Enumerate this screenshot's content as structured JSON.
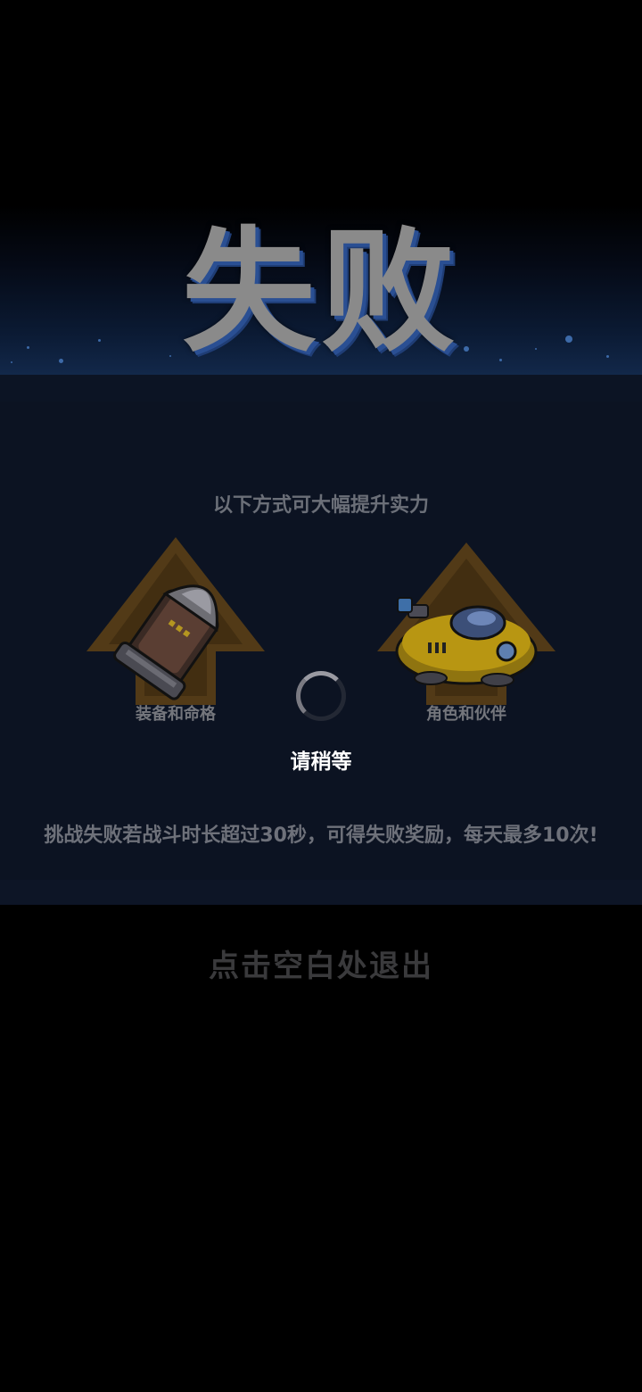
{
  "header": {
    "title": "失败"
  },
  "panel": {
    "subtitle": "以下方式可大幅提升实力",
    "options": [
      {
        "label": "装备和命格",
        "icon": "equipment-icon"
      },
      {
        "label": "角色和伙伴",
        "icon": "vehicle-icon"
      }
    ],
    "loading_label": "请稍等",
    "notice": "挑战失败若战斗时长超过30秒，可得失败奖励，每天最多10次!"
  },
  "footer": {
    "exit_hint": "点击空白处退出"
  },
  "colors": {
    "title": "#8a8a8a",
    "title_shadow": "#2a4f93",
    "panel_bg": "#0c1322",
    "text_muted": "#6e717a",
    "arrow": "#6a4a18"
  }
}
